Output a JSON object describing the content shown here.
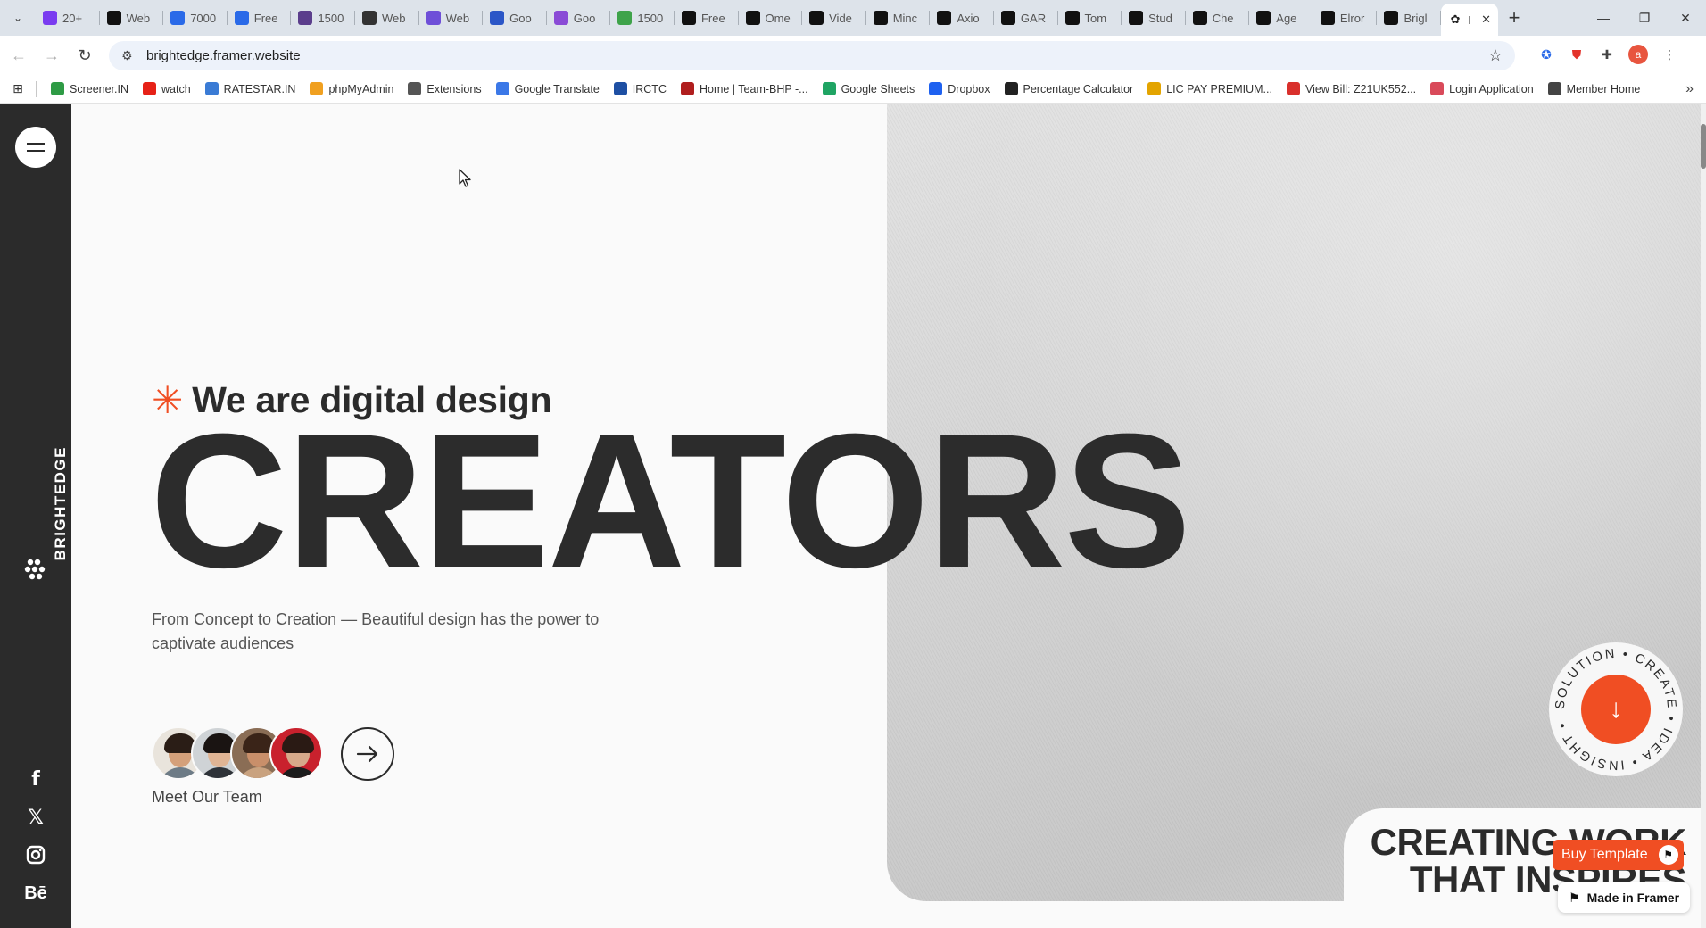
{
  "browser": {
    "tabs": [
      {
        "label": "20+",
        "icon": "purple-a-icon",
        "color": "#7a3cf0"
      },
      {
        "label": "Web",
        "icon": "wix-icon",
        "color": "#111111"
      },
      {
        "label": "7000",
        "icon": "webflow-icon",
        "color": "#2a6ae8"
      },
      {
        "label": "Free",
        "icon": "webflow-icon",
        "color": "#2a6ae8"
      },
      {
        "label": "1500",
        "icon": "theme-icon",
        "color": "#5b3e8c"
      },
      {
        "label": "Web",
        "icon": "layers-icon",
        "color": "#333333"
      },
      {
        "label": "Web",
        "icon": "h-icon",
        "color": "#6e4fd8"
      },
      {
        "label": "Goo",
        "icon": "template-icon",
        "color": "#2b56c7"
      },
      {
        "label": "Goo",
        "icon": "circle-icon",
        "color": "#8a4bd6"
      },
      {
        "label": "1500",
        "icon": "leaf-icon",
        "color": "#3ea34a"
      },
      {
        "label": "Free",
        "icon": "framer-icon",
        "color": "#111111"
      },
      {
        "label": "Ome",
        "icon": "framer-icon",
        "color": "#111111"
      },
      {
        "label": "Vide",
        "icon": "framer-icon",
        "color": "#111111"
      },
      {
        "label": "Minc",
        "icon": "framer-icon",
        "color": "#111111"
      },
      {
        "label": "Axio",
        "icon": "framer-icon",
        "color": "#111111"
      },
      {
        "label": "GAR",
        "icon": "framer-icon",
        "color": "#111111"
      },
      {
        "label": "Tom",
        "icon": "framer-icon",
        "color": "#111111"
      },
      {
        "label": "Stud",
        "icon": "framer-icon",
        "color": "#111111"
      },
      {
        "label": "Che",
        "icon": "framer-icon",
        "color": "#111111"
      },
      {
        "label": "Age",
        "icon": "framer-icon",
        "color": "#111111"
      },
      {
        "label": "Elror",
        "icon": "framer-icon",
        "color": "#111111"
      },
      {
        "label": "Brigl",
        "icon": "framer-icon",
        "color": "#111111"
      }
    ],
    "active_tab": {
      "label": "I",
      "icon": "brightedge-icon"
    },
    "url": "brightedge.framer.website",
    "profile_initial": "a",
    "bookmarks": [
      {
        "label": "Screener.IN",
        "color": "#2e9b45"
      },
      {
        "label": "watch",
        "color": "#e62117"
      },
      {
        "label": "RATESTAR.IN",
        "color": "#3a7bd5"
      },
      {
        "label": "phpMyAdmin",
        "color": "#f0a020"
      },
      {
        "label": "Extensions",
        "color": "#555555"
      },
      {
        "label": "Google Translate",
        "color": "#3b78e7"
      },
      {
        "label": "IRCTC",
        "color": "#1e4fa3"
      },
      {
        "label": "Home | Team-BHP -...",
        "color": "#b01e1e"
      },
      {
        "label": "Google Sheets",
        "color": "#1fa463"
      },
      {
        "label": "Dropbox",
        "color": "#1e61f0"
      },
      {
        "label": "Percentage Calculator",
        "color": "#222222"
      },
      {
        "label": "LIC PAY PREMIUM...",
        "color": "#e3a400"
      },
      {
        "label": "View Bill: Z21UK552...",
        "color": "#d9302c"
      },
      {
        "label": "Login Application",
        "color": "#d94a5a"
      },
      {
        "label": "Member Home",
        "color": "#444444"
      }
    ]
  },
  "site": {
    "brand": "BRIGHTEDGE",
    "intro": "We are digital design",
    "headline": "CREATORS",
    "tagline": "From Concept to Creation — Beautiful design has the power to captivate audiences",
    "team_label": "Meet Our Team",
    "badge_text": "SOLUTION • CREATE • IDEA • INSIGHT •",
    "creating_line1": "CREATING WORK",
    "creating_line2": "THAT INSPIRES",
    "buy_label": "Buy Template",
    "framer_label": "Made in Framer",
    "accent": "#f04e23",
    "dark": "#2b2b2b"
  }
}
